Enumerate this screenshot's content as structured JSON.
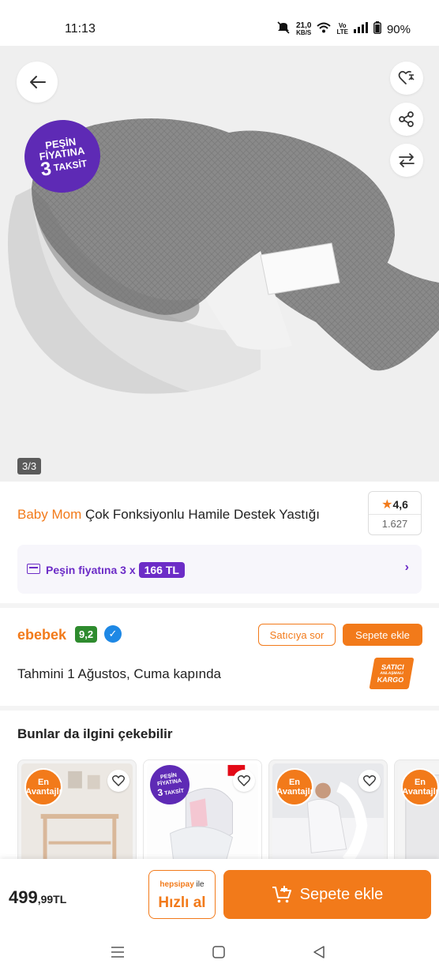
{
  "status_bar": {
    "time": "11:13",
    "net_speed_top": "21,0",
    "net_speed_unit": "KB/S",
    "volte_top": "Vo",
    "volte_bottom": "LTE",
    "battery": "90%"
  },
  "product_image": {
    "promo_line1": "PEŞİN",
    "promo_line2": "FİYATINA",
    "promo_number": "3",
    "promo_line3": "TAKSİT",
    "pager": "3/3"
  },
  "product": {
    "brand": "Baby Mom",
    "name": " Çok Fonksiyonlu Hamile Destek Yastığı",
    "rating": "4,6",
    "review_count": "1.627"
  },
  "installment": {
    "text": "Peşin fiyatına 3 x",
    "amount": "166 TL"
  },
  "seller": {
    "name": "ebebek",
    "score": "9,2",
    "ask_label": "Satıcıya sor",
    "add_label": "Sepete ekle",
    "delivery": "Tahmini 1 Ağustos, Cuma kapında",
    "cargo_line1": "SATICI",
    "cargo_line2": "ANLAŞMALI",
    "cargo_line3": "KARGO"
  },
  "recommendations": {
    "title": "Bunlar da ilgini çekebilir",
    "badge_line1": "En",
    "badge_line2": "Avantajlı",
    "promo_line1": "PEŞİN",
    "promo_line2": "FİYATINA",
    "promo_number": "3",
    "promo_line3": "TAKSİT"
  },
  "buy_bar": {
    "price_main": "499",
    "price_decimal": ",99TL",
    "hepsipay": "hepsipay",
    "hepsipay_ile": " ile",
    "quick_label": "Hızlı al",
    "add_label": "Sepete ekle"
  },
  "colors": {
    "accent": "#f27a1a",
    "promo_purple": "#5e2ab5",
    "seller_score": "#2e8b2e"
  }
}
